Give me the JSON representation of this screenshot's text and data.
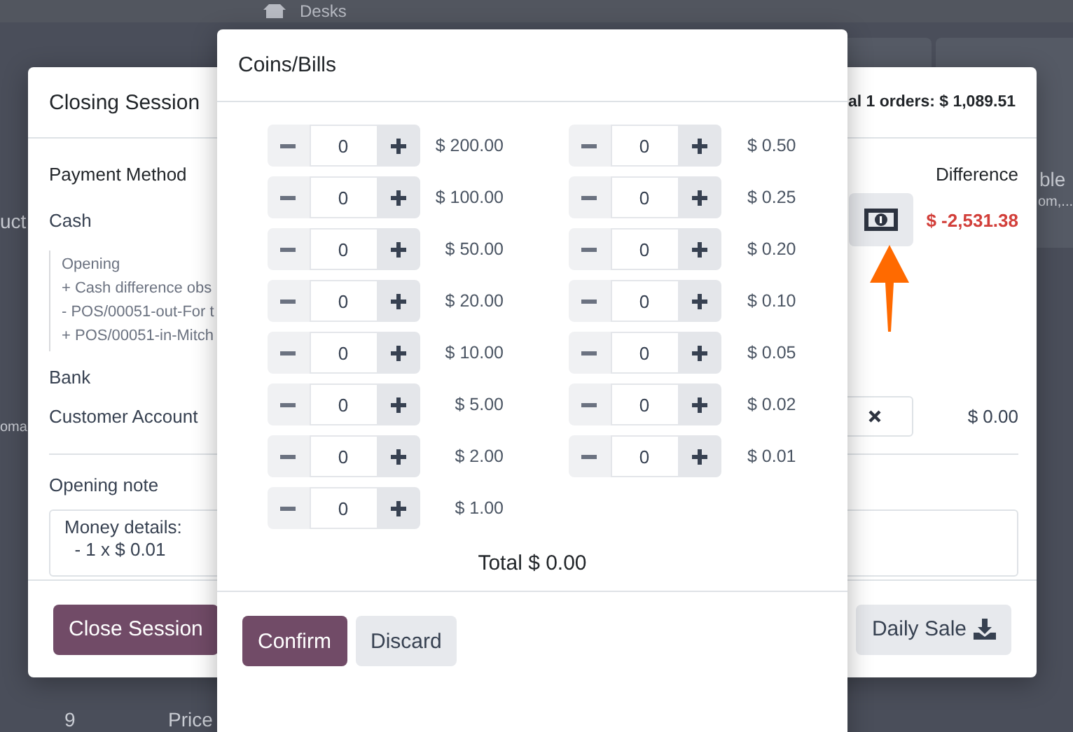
{
  "background": {
    "breadcrumb": "Desks",
    "fragments": [
      "uct",
      "oma",
      "9",
      "Price",
      "ble",
      "om,..."
    ]
  },
  "closing_session": {
    "title": "Closing Session",
    "orders_summary": "al 1 orders: $ 1,089.51",
    "columns": [
      "Payment Method",
      "Difference"
    ],
    "payment_methods": [
      {
        "kind": "cash",
        "name": "Cash",
        "difference": "$ -2,531.38",
        "negative": true,
        "details": [
          "Opening",
          "+ Cash difference obs",
          "- POS/00051-out-For t",
          "+ POS/00051-in-Mitch"
        ]
      },
      {
        "kind": "plain",
        "name": "Bank"
      },
      {
        "kind": "field",
        "name": "Customer Account",
        "difference": "$ 0.00",
        "negative": false
      }
    ],
    "opening_note": {
      "label": "Opening note",
      "lines": [
        "Money details:",
        "  - 1 x $ 0.01"
      ]
    },
    "buttons": [
      {
        "label": "Close Session",
        "kind": "primary"
      },
      {
        "label": "Daily Sale",
        "kind": "download"
      }
    ]
  },
  "coins_bills": {
    "title": "Coins/Bills",
    "bills": [
      {
        "value": "$ 200.00",
        "quantity": "0"
      },
      {
        "value": "$ 100.00",
        "quantity": "0"
      },
      {
        "value": "$ 50.00",
        "quantity": "0"
      },
      {
        "value": "$ 20.00",
        "quantity": "0"
      },
      {
        "value": "$ 10.00",
        "quantity": "0"
      },
      {
        "value": "$ 5.00",
        "quantity": "0"
      },
      {
        "value": "$ 2.00",
        "quantity": "0"
      },
      {
        "value": "$ 1.00",
        "quantity": "0"
      }
    ],
    "coins": [
      {
        "value": "$ 0.50",
        "quantity": "0"
      },
      {
        "value": "$ 0.25",
        "quantity": "0"
      },
      {
        "value": "$ 0.20",
        "quantity": "0"
      },
      {
        "value": "$ 0.10",
        "quantity": "0"
      },
      {
        "value": "$ 0.05",
        "quantity": "0"
      },
      {
        "value": "$ 0.02",
        "quantity": "0"
      },
      {
        "value": "$ 0.01",
        "quantity": "0"
      }
    ],
    "total": "Total $ 0.00",
    "buttons": [
      {
        "label": "Confirm",
        "kind": "primary"
      },
      {
        "label": "Discard",
        "kind": "secondary"
      }
    ]
  }
}
